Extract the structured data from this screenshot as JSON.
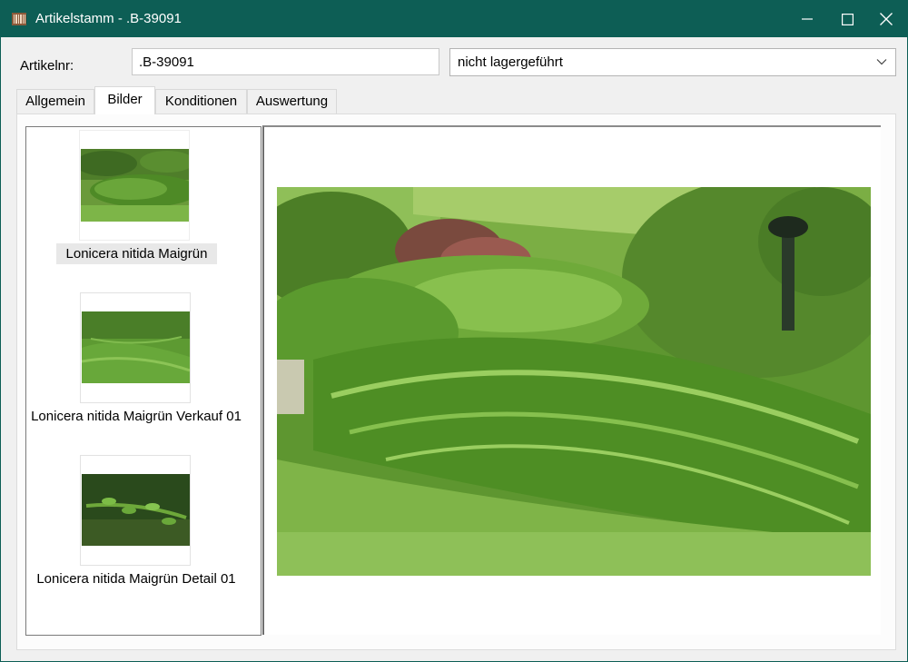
{
  "window": {
    "title": "Artikelstamm - .B-39091",
    "app_icon": "barcode-icon",
    "controls": {
      "minimize": "minimize-icon",
      "maximize": "maximize-icon",
      "close": "close-icon"
    },
    "accent_color": "#0d5e55"
  },
  "header": {
    "artikelnr_label": "Artikelnr:",
    "artikelnr_value": ".B-39091",
    "lager_status": "nicht lagergeführt"
  },
  "tabs": [
    {
      "label": "Allgemein",
      "active": false
    },
    {
      "label": "Bilder",
      "active": true
    },
    {
      "label": "Konditionen",
      "active": false
    },
    {
      "label": "Auswertung",
      "active": false
    }
  ],
  "images": [
    {
      "label": "Lonicera nitida Maigrün",
      "selected": true
    },
    {
      "label": "Lonicera nitida Maigrün Verkauf 01",
      "selected": false
    },
    {
      "label": "Lonicera nitida Maigrün Detail 01",
      "selected": false
    }
  ]
}
